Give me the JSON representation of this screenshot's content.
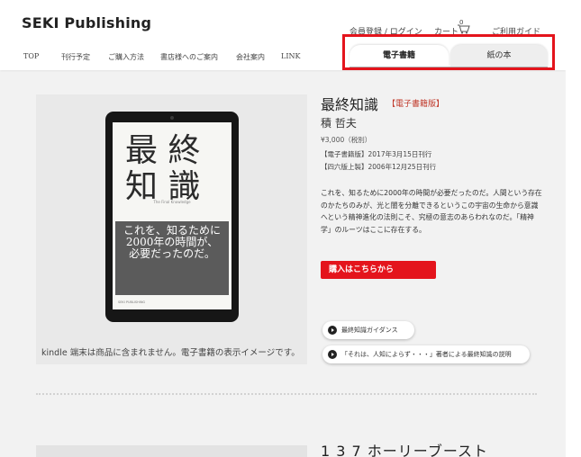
{
  "header": {
    "logo": "SEKI Publishing",
    "utility": {
      "register_login": "会員登録 / ログイン",
      "cart": "カート",
      "cart_count": "0",
      "guide": "ご利用ガイド"
    },
    "nav": [
      "TOP",
      "刊行予定",
      "ご購入方法",
      "書店様へのご案内",
      "会社案内",
      "LINK"
    ],
    "tabs": [
      {
        "label": "電子書籍",
        "active": true
      },
      {
        "label": "紙の本",
        "active": false
      }
    ],
    "highlight_color": "#e4141c"
  },
  "book": {
    "cover": {
      "line1": "最 終",
      "line2": "知 識",
      "subtitle": "The Final Knowledge",
      "band_text": "これを、知るために\n2000年の時間が、\n必要だったのだ。",
      "publisher_fine": "SEKI PUBLISHING"
    },
    "caption": "kindle 端末は商品に含まれません。電子書籍の表示イメージです。",
    "title": "最終知識",
    "format_badge": "【電子書籍版】",
    "author": "積 哲夫",
    "price": "¥3,000（税別）",
    "dates": [
      "【電子書籍版】2017年3月15日刊行",
      "【四六版上製】2006年12月25日刊行"
    ],
    "description": "これを、知るために2000年の時間が必要だったのだ。人間という存在のかたちのみが、光と闇を分離できるというこの宇宙の生命から意識へという精神進化の法則こそ、究極の意志のあらわれなのだ。「精神学」のルーツはここに存在する。",
    "buy_button": "購入はこちらから",
    "links": [
      "最終知識ガイダンス",
      "「それは、人知によらず・・・」著者による最終知識の説明"
    ],
    "accent_color": "#e4141c"
  },
  "next_book": {
    "title": "1 3 7 ホーリーブースト"
  }
}
